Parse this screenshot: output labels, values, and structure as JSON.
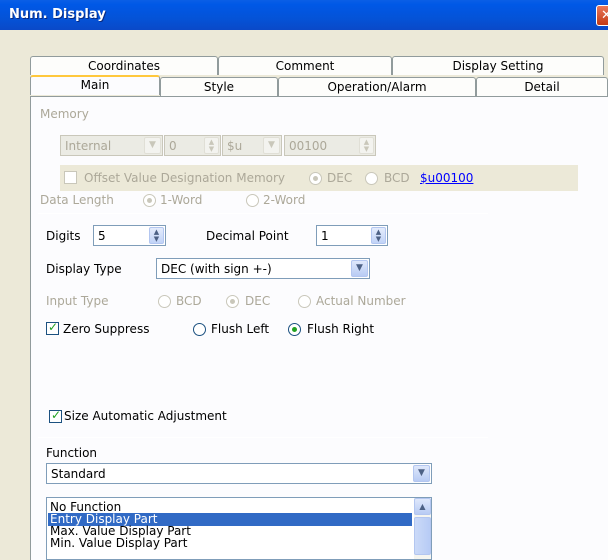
{
  "window": {
    "title": "Num. Display",
    "close_glyph": "✕"
  },
  "tabs_row1": [
    "Coordinates",
    "Comment",
    "Display Setting"
  ],
  "tabs_row2": [
    "Main",
    "Style",
    "Operation/Alarm",
    "Detail"
  ],
  "memory": {
    "label": "Memory",
    "type": "Internal",
    "number": "0",
    "prefix": "$u",
    "address": "00100",
    "offset_label": "Offset Value Designation Memory",
    "dec_label": "DEC",
    "bcd_label": "BCD",
    "offset_link": "$u00100",
    "data_length_label": "Data Length",
    "one_word": "1-Word",
    "two_word": "2-Word"
  },
  "digits": {
    "label": "Digits",
    "value": "5"
  },
  "decimal_point": {
    "label": "Decimal Point",
    "value": "1"
  },
  "display_type": {
    "label": "Display Type",
    "value": "DEC (with sign +-)"
  },
  "input_type": {
    "label": "Input Type",
    "bcd": "BCD",
    "dec": "DEC",
    "actual": "Actual Number"
  },
  "zero_suppress": {
    "label": "Zero Suppress",
    "checked": true
  },
  "flush_left": "Flush Left",
  "flush_right": "Flush Right",
  "size_auto": {
    "label": "Size Automatic Adjustment",
    "checked": true
  },
  "function": {
    "label": "Function",
    "value": "Standard",
    "list": [
      "No Function",
      "Entry Display Part",
      "Max. Value Display Part",
      "Min. Value Display Part"
    ],
    "selected_index": 1
  },
  "icons": {
    "dropdown": "chevron-down-icon",
    "spinner": "spin-arrows-icon",
    "check": "check-icon"
  },
  "colors": {
    "title_bar": "#0453d8",
    "selection": "#316ac5",
    "check_green": "#21a121",
    "tab_highlight": "#ffc83c"
  }
}
